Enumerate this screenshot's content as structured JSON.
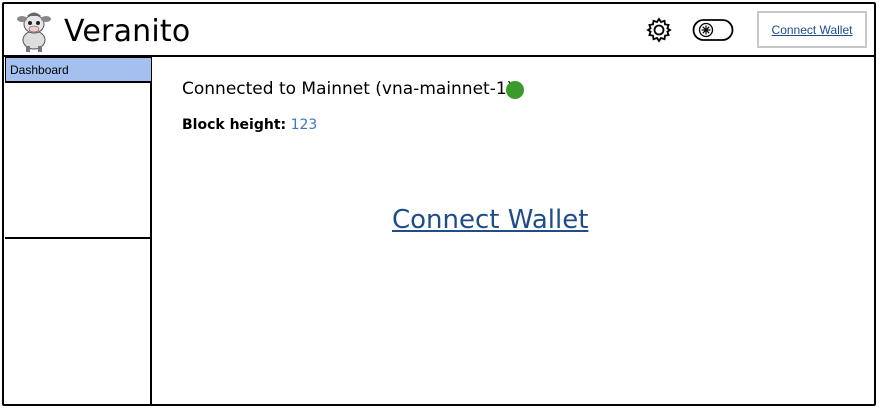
{
  "app": {
    "title": "Veranito",
    "logo_icon": "cow-mascot-icon"
  },
  "header": {
    "settings_icon": "gear-icon",
    "theme_toggle_icon": "toggle-icon",
    "connect_label": "Connect Wallet"
  },
  "sidebar": {
    "items": [
      {
        "label": "Dashboard",
        "active": true
      }
    ]
  },
  "main": {
    "connection_text": "Connected to Mainnet (vna-mainnet-1)",
    "status_color": "#3a9a2c",
    "block_height_label": "Block height:",
    "block_height_value": "123",
    "connect_link": "Connect Wallet"
  },
  "colors": {
    "accent": "#a3c0ef",
    "link": "#1f4d8a",
    "value": "#3a78c3"
  }
}
